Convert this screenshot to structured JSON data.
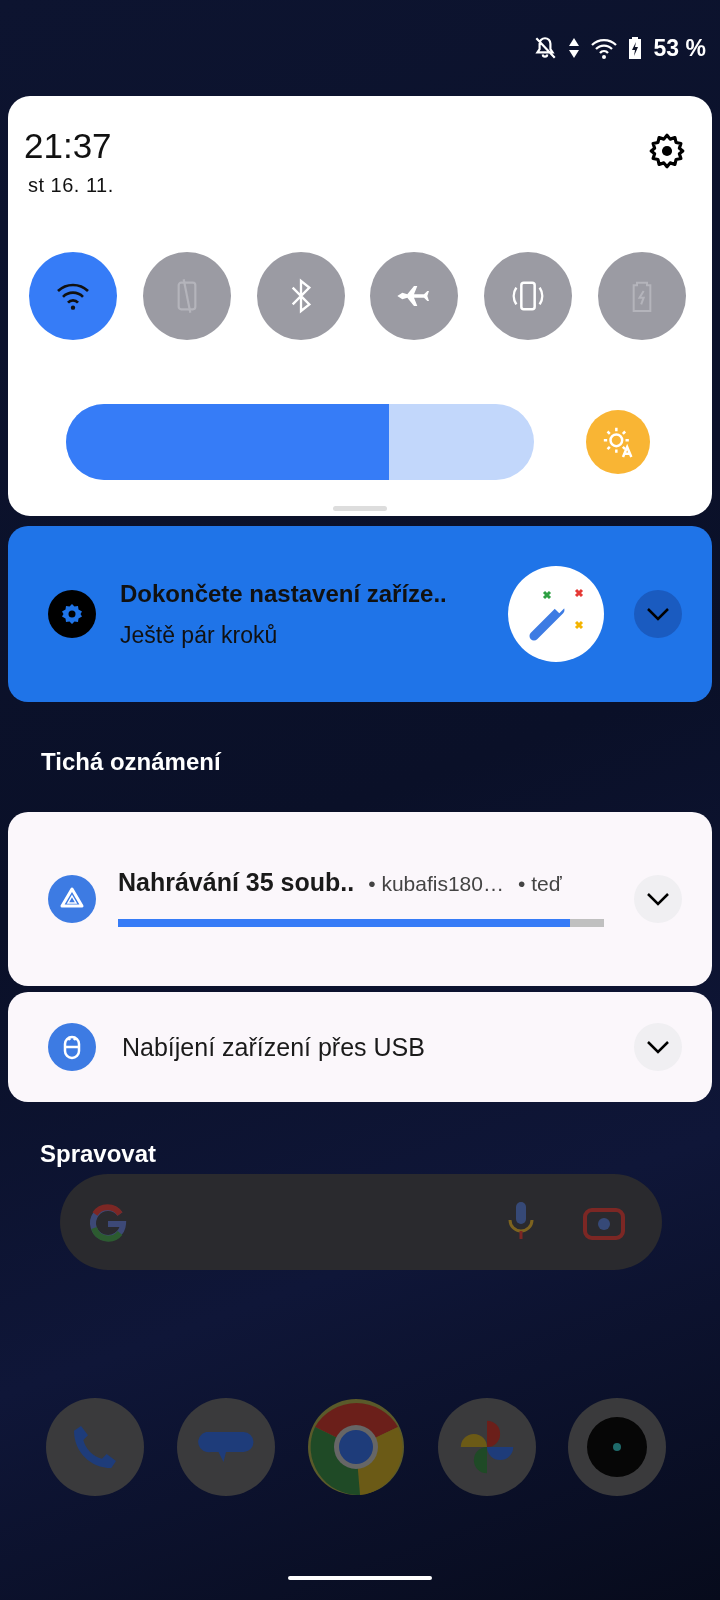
{
  "status_bar": {
    "battery": "53 %"
  },
  "quick_settings": {
    "time": "21:37",
    "date": "st 16. 11.",
    "toggles": [
      {
        "kind": "wifi",
        "on": true,
        "disabled": false
      },
      {
        "kind": "rotation",
        "on": false,
        "disabled": true
      },
      {
        "kind": "bluetooth",
        "on": false,
        "disabled": false
      },
      {
        "kind": "airplane",
        "on": false,
        "disabled": false
      },
      {
        "kind": "vibrate",
        "on": false,
        "disabled": false
      },
      {
        "kind": "battery_saver",
        "on": false,
        "disabled": true
      }
    ],
    "brightness": {
      "level": 0.69,
      "auto": true
    }
  },
  "setup_notification": {
    "title": "Dokončete nastavení zaříze..",
    "text": "Ještě pár kroků"
  },
  "silent_section": {
    "title": "Tichá oznámení"
  },
  "notifications": [
    {
      "kind": "upload",
      "title": "Nahrávání 35 soub..",
      "account": "• kubafis180…",
      "time": "• teď",
      "level": 0.93
    },
    {
      "kind": "usb",
      "title": "Nabíjení zařízení přes USB"
    }
  ],
  "manage": {
    "label": "Spravovat"
  }
}
